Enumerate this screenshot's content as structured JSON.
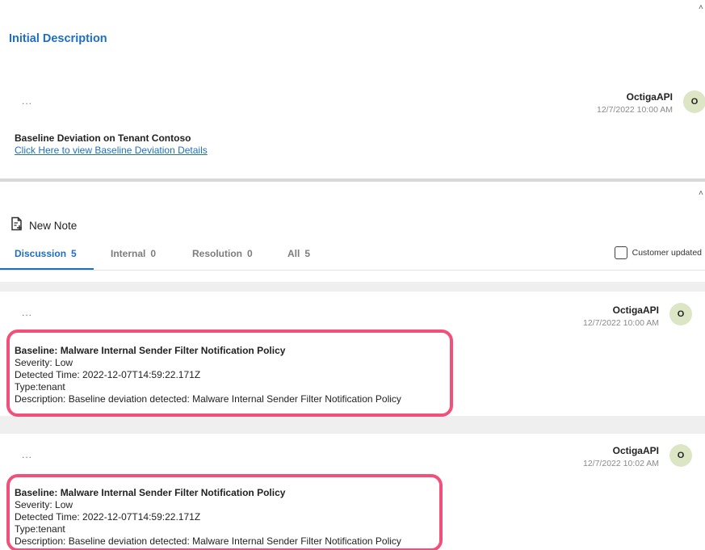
{
  "initial_description": {
    "title": "Initial Description",
    "more": "...",
    "author": "OctigaAPI",
    "timestamp": "12/7/2022 10:00 AM",
    "avatar": "O",
    "body_title": "Baseline Deviation on Tenant Contoso",
    "link_text": "Click Here to view Baseline Deviation Details"
  },
  "new_note_label": "New Note",
  "tabs": [
    {
      "label": "Discussion",
      "count": "5"
    },
    {
      "label": "Internal",
      "count": "0"
    },
    {
      "label": "Resolution",
      "count": "0"
    },
    {
      "label": "All",
      "count": "5"
    }
  ],
  "customer_updated_label": "Customer updated",
  "notes": [
    {
      "more": "...",
      "author": "OctigaAPI",
      "timestamp": "12/7/2022 10:00 AM",
      "avatar": "O",
      "title": "Baseline: Malware Internal Sender Filter Notification Policy",
      "severity": "Severity: Low",
      "detected": "Detected Time: 2022-12-07T14:59:22.171Z",
      "type": "Type:tenant",
      "description": "Description: Baseline deviation detected: Malware Internal Sender Filter Notification Policy"
    },
    {
      "more": "...",
      "author": "OctigaAPI",
      "timestamp": "12/7/2022 10:02 AM",
      "avatar": "O",
      "title": "Baseline: Malware Internal Sender Filter Notification Policy",
      "severity": "Severity: Low",
      "detected": "Detected Time: 2022-12-07T14:59:22.171Z",
      "type": "Type:tenant",
      "description": "Description: Baseline deviation detected: Malware Internal Sender Filter Notification Policy"
    }
  ],
  "colors": {
    "accent": "#1f6fc0",
    "highlight": "#f0507a",
    "avatar_bg": "#dce6c4"
  }
}
